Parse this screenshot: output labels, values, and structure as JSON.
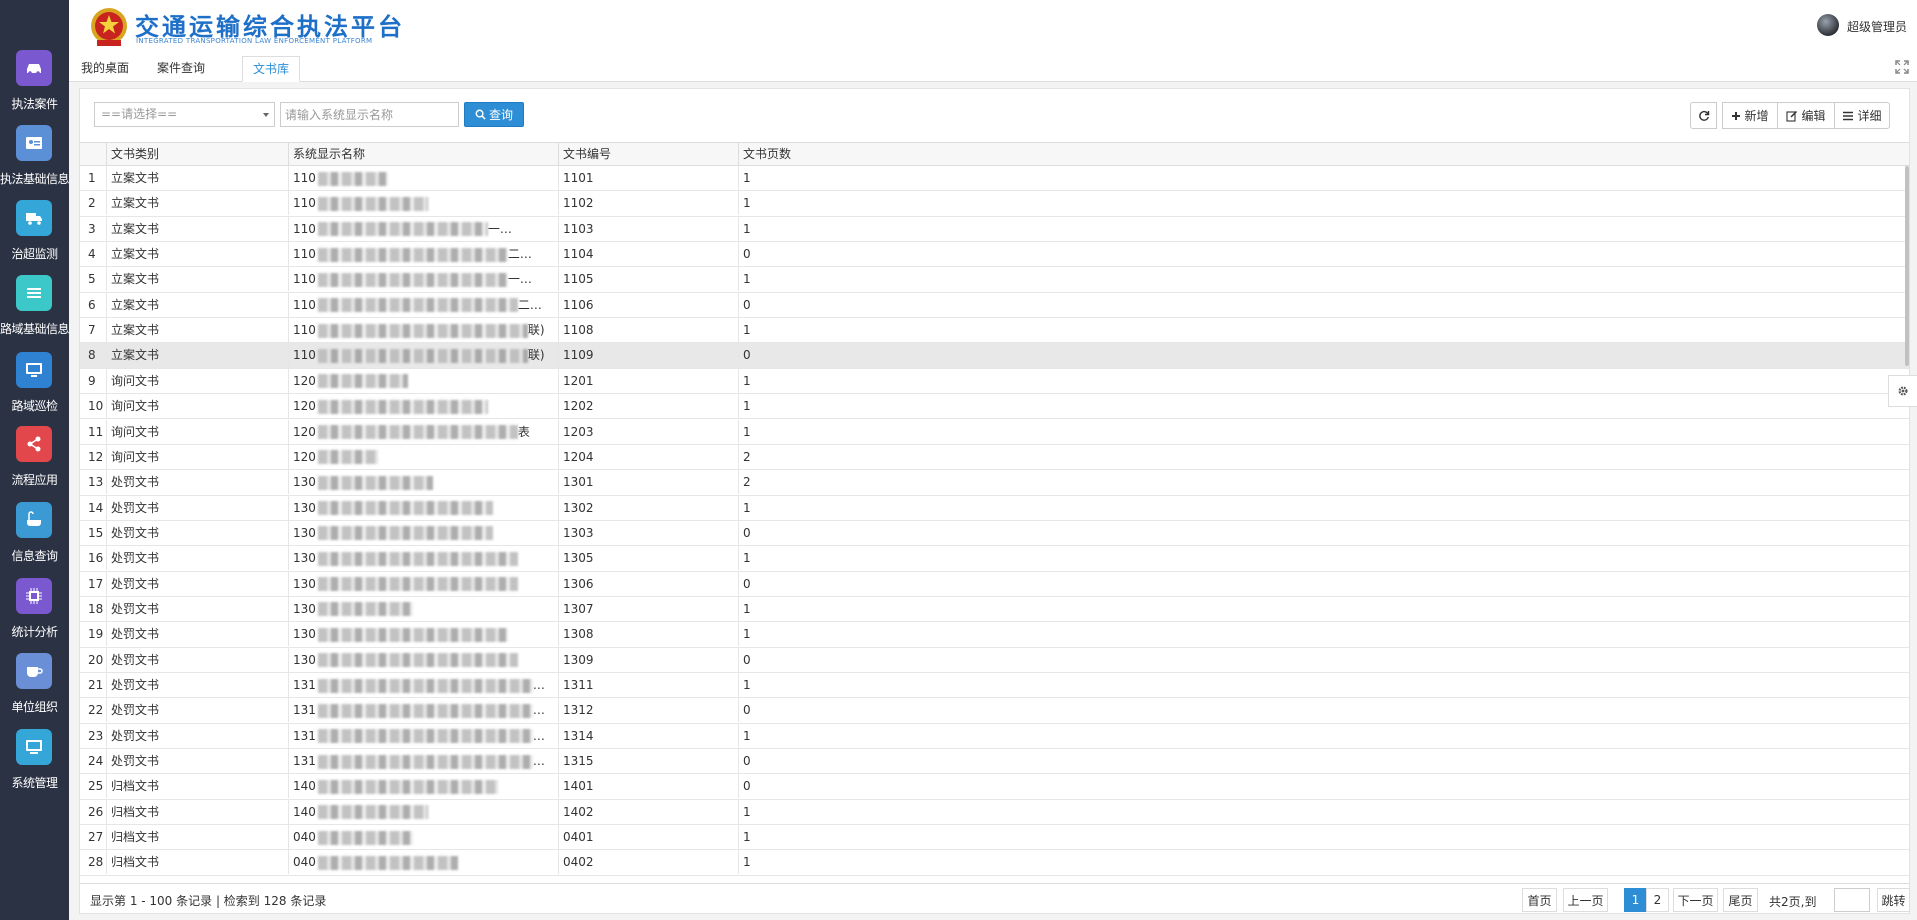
{
  "colors": {
    "sidebar_bg": "#2b3243",
    "accent": "#2d8ed6",
    "nav_icon_colors": [
      "#7a58cf",
      "#5b8fd6",
      "#34a7d8",
      "#3cc7c9",
      "#2f82d1",
      "#e2484b",
      "#3b9ad4",
      "#7a58cf",
      "#6a8fd6",
      "#34a7d8"
    ]
  },
  "sidebar": {
    "items": [
      {
        "label": "执法案件",
        "icon": "car-icon"
      },
      {
        "label": "执法基础信息",
        "icon": "id-card-icon"
      },
      {
        "label": "治超监测",
        "icon": "truck-icon"
      },
      {
        "label": "路域基础信息",
        "icon": "list-icon"
      },
      {
        "label": "路域巡检",
        "icon": "monitor-icon"
      },
      {
        "label": "流程应用",
        "icon": "share-icon"
      },
      {
        "label": "信息查询",
        "icon": "bath-icon"
      },
      {
        "label": "统计分析",
        "icon": "chip-icon"
      },
      {
        "label": "单位组织",
        "icon": "coffee-icon"
      },
      {
        "label": "系统管理",
        "icon": "desktop-icon"
      }
    ]
  },
  "header": {
    "title": "交通运输综合执法平台",
    "subtitle": "INTEGRATED TRANSPORTATION LAW ENFORCEMENT PLATFORM",
    "user_name": "超级管理员"
  },
  "tabs": [
    {
      "label": "我的桌面",
      "active": false
    },
    {
      "label": "案件查询",
      "active": false
    },
    {
      "label": "文书库",
      "active": true
    }
  ],
  "toolbar": {
    "select_placeholder": "==请选择==",
    "search_placeholder": "请输入系统显示名称",
    "search_label": "查询",
    "add_label": "新增",
    "edit_label": "编辑",
    "detail_label": "详细"
  },
  "table": {
    "columns": [
      "文书类别",
      "系统显示名称",
      "文书编号",
      "文书页数"
    ],
    "rows": [
      {
        "no": "1",
        "category": "立案文书",
        "name_prefix": "110",
        "name_suffix": "",
        "code": "1101",
        "pages": "1"
      },
      {
        "no": "2",
        "category": "立案文书",
        "name_prefix": "110",
        "name_suffix": "",
        "code": "1102",
        "pages": "1"
      },
      {
        "no": "3",
        "category": "立案文书",
        "name_prefix": "110",
        "name_suffix": "一…",
        "code": "1103",
        "pages": "1"
      },
      {
        "no": "4",
        "category": "立案文书",
        "name_prefix": "110",
        "name_suffix": "二…",
        "code": "1104",
        "pages": "0"
      },
      {
        "no": "5",
        "category": "立案文书",
        "name_prefix": "110",
        "name_suffix": "一…",
        "code": "1105",
        "pages": "1"
      },
      {
        "no": "6",
        "category": "立案文书",
        "name_prefix": "110",
        "name_suffix": "二…",
        "code": "1106",
        "pages": "0"
      },
      {
        "no": "7",
        "category": "立案文书",
        "name_prefix": "110",
        "name_suffix": "联)",
        "code": "1108",
        "pages": "1"
      },
      {
        "no": "8",
        "category": "立案文书",
        "name_prefix": "110",
        "name_suffix": "联)",
        "code": "1109",
        "pages": "0"
      },
      {
        "no": "9",
        "category": "询问文书",
        "name_prefix": "120",
        "name_suffix": "",
        "code": "1201",
        "pages": "1"
      },
      {
        "no": "10",
        "category": "询问文书",
        "name_prefix": "120",
        "name_suffix": "",
        "code": "1202",
        "pages": "1"
      },
      {
        "no": "11",
        "category": "询问文书",
        "name_prefix": "120",
        "name_suffix": "表",
        "code": "1203",
        "pages": "1"
      },
      {
        "no": "12",
        "category": "询问文书",
        "name_prefix": "120",
        "name_suffix": "",
        "code": "1204",
        "pages": "2"
      },
      {
        "no": "13",
        "category": "处罚文书",
        "name_prefix": "130",
        "name_suffix": "",
        "code": "1301",
        "pages": "2"
      },
      {
        "no": "14",
        "category": "处罚文书",
        "name_prefix": "130",
        "name_suffix": "",
        "code": "1302",
        "pages": "1"
      },
      {
        "no": "15",
        "category": "处罚文书",
        "name_prefix": "130",
        "name_suffix": "",
        "code": "1303",
        "pages": "0"
      },
      {
        "no": "16",
        "category": "处罚文书",
        "name_prefix": "130",
        "name_suffix": "",
        "code": "1305",
        "pages": "1"
      },
      {
        "no": "17",
        "category": "处罚文书",
        "name_prefix": "130",
        "name_suffix": "",
        "code": "1306",
        "pages": "0"
      },
      {
        "no": "18",
        "category": "处罚文书",
        "name_prefix": "130",
        "name_suffix": "",
        "code": "1307",
        "pages": "1"
      },
      {
        "no": "19",
        "category": "处罚文书",
        "name_prefix": "130",
        "name_suffix": "",
        "code": "1308",
        "pages": "1"
      },
      {
        "no": "20",
        "category": "处罚文书",
        "name_prefix": "130",
        "name_suffix": "",
        "code": "1309",
        "pages": "0"
      },
      {
        "no": "21",
        "category": "处罚文书",
        "name_prefix": "131",
        "name_suffix": "…",
        "code": "1311",
        "pages": "1"
      },
      {
        "no": "22",
        "category": "处罚文书",
        "name_prefix": "131",
        "name_suffix": "…",
        "code": "1312",
        "pages": "0"
      },
      {
        "no": "23",
        "category": "处罚文书",
        "name_prefix": "131",
        "name_suffix": "…",
        "code": "1314",
        "pages": "1"
      },
      {
        "no": "24",
        "category": "处罚文书",
        "name_prefix": "131",
        "name_suffix": "…",
        "code": "1315",
        "pages": "0"
      },
      {
        "no": "25",
        "category": "归档文书",
        "name_prefix": "140",
        "name_suffix": "",
        "code": "1401",
        "pages": "0"
      },
      {
        "no": "26",
        "category": "归档文书",
        "name_prefix": "140",
        "name_suffix": "",
        "code": "1402",
        "pages": "1"
      },
      {
        "no": "27",
        "category": "归档文书",
        "name_prefix": "040",
        "name_suffix": "",
        "code": "0401",
        "pages": "1"
      },
      {
        "no": "28",
        "category": "归档文书",
        "name_prefix": "040",
        "name_suffix": "",
        "code": "0402",
        "pages": "1"
      }
    ],
    "selected_row": 8
  },
  "footer": {
    "page_info": "显示第 1 - 100 条记录 | 检索到 128 条记录",
    "first": "首页",
    "prev": "上一页",
    "pages": [
      "1",
      "2"
    ],
    "current_page": "1",
    "next": "下一页",
    "last": "尾页",
    "total": "共2页,到",
    "jump": "跳转"
  }
}
